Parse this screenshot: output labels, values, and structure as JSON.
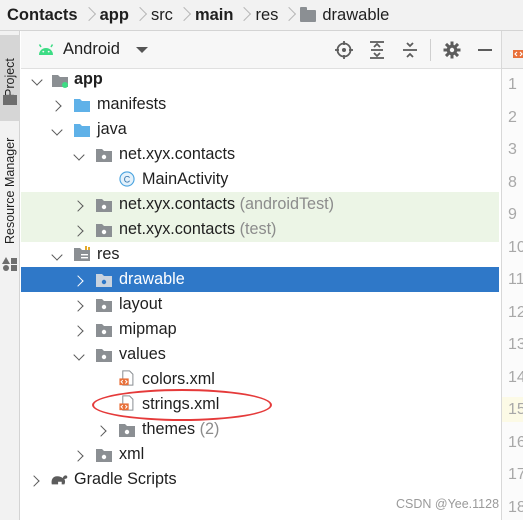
{
  "breadcrumb": {
    "items": [
      "Contacts",
      "app",
      "src",
      "main",
      "res",
      "drawable"
    ]
  },
  "side_strip": {
    "project_tab": "Project",
    "resource_tab": "Resource Manager"
  },
  "toolbar": {
    "view_selector": "Android",
    "icons": [
      "target-icon",
      "expand-all-icon",
      "collapse-all-icon",
      "gear-icon",
      "minimize-icon"
    ]
  },
  "tree": {
    "app": "app",
    "manifests": "manifests",
    "java": "java",
    "pkg_main": "net.xyx.contacts",
    "main_activity": "MainActivity",
    "pkg_android_test": "net.xyx.contacts",
    "pkg_android_test_suffix": "(androidTest)",
    "pkg_test": "net.xyx.contacts",
    "pkg_test_suffix": "(test)",
    "res": "res",
    "drawable": "drawable",
    "layout": "layout",
    "mipmap": "mipmap",
    "values": "values",
    "colors_xml": "colors.xml",
    "strings_xml": "strings.xml",
    "themes": "themes",
    "themes_count": "(2)",
    "xml": "xml",
    "gradle_scripts": "Gradle Scripts"
  },
  "gutter": {
    "line_numbers": [
      "1",
      "2",
      "3",
      "8",
      "9",
      "10",
      "11",
      "12",
      "13",
      "14",
      "15",
      "16",
      "17",
      "18"
    ]
  },
  "watermark": "CSDN @Yee.1128",
  "colors": {
    "selection": "#2f78c8",
    "test_source_bg": "#ecf5e6",
    "annotation": "#e53a3a",
    "android_green": "#3ddc84"
  }
}
